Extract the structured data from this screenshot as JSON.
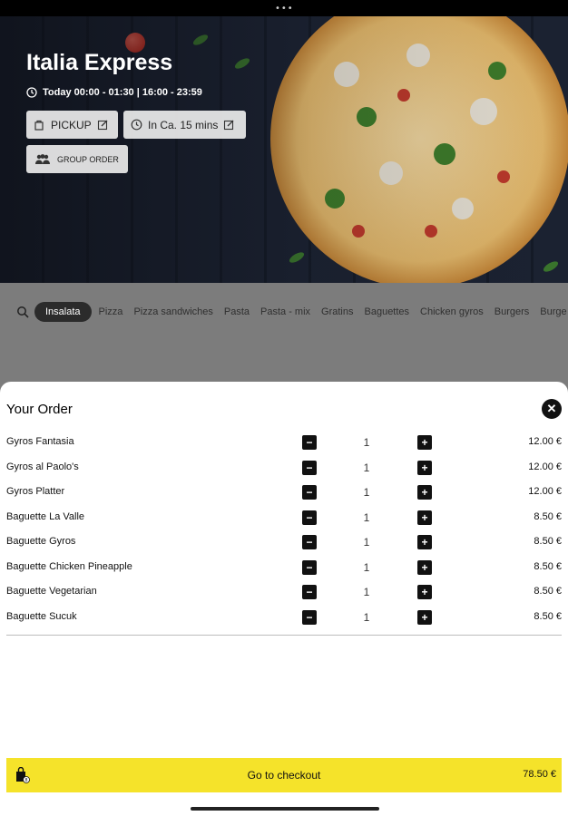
{
  "status": {
    "dots": "•••"
  },
  "store": {
    "title": "Italia Express",
    "hours": "Today 00:00 - 01:30 | 16:00 - 23:59",
    "pickup_label": "PICKUP",
    "time_label": "In Ca. 15 mins",
    "group_order_label": "GROUP ORDER"
  },
  "categories": [
    {
      "label": "Insalata",
      "active": true
    },
    {
      "label": "Pizza"
    },
    {
      "label": "Pizza sandwiches"
    },
    {
      "label": "Pasta"
    },
    {
      "label": "Pasta - mix"
    },
    {
      "label": "Gratins"
    },
    {
      "label": "Baguettes"
    },
    {
      "label": "Chicken gyros"
    },
    {
      "label": "Burgers"
    },
    {
      "label": "Burge"
    }
  ],
  "order": {
    "title": "Your Order",
    "close_icon": "close-icon",
    "items": [
      {
        "name": "Gyros Fantasia",
        "qty": "1",
        "price": "12.00 €"
      },
      {
        "name": "Gyros al Paolo's",
        "qty": "1",
        "price": "12.00 €"
      },
      {
        "name": "Gyros Platter",
        "qty": "1",
        "price": "12.00 €"
      },
      {
        "name": "Baguette La Valle",
        "qty": "1",
        "price": "8.50 €"
      },
      {
        "name": "Baguette Gyros",
        "qty": "1",
        "price": "8.50 €"
      },
      {
        "name": "Baguette Chicken Pineapple",
        "qty": "1",
        "price": "8.50 €"
      },
      {
        "name": "Baguette Vegetarian",
        "qty": "1",
        "price": "8.50 €"
      },
      {
        "name": "Baguette Sucuk",
        "qty": "1",
        "price": "8.50 €"
      }
    ],
    "minus_symbol": "−",
    "plus_symbol": "+"
  },
  "checkout": {
    "label": "Go to checkout",
    "total": "78.50 €"
  },
  "colors": {
    "accent_yellow": "#f5e32a",
    "dark": "#111111",
    "overlay_gray": "#7c7c7c"
  }
}
